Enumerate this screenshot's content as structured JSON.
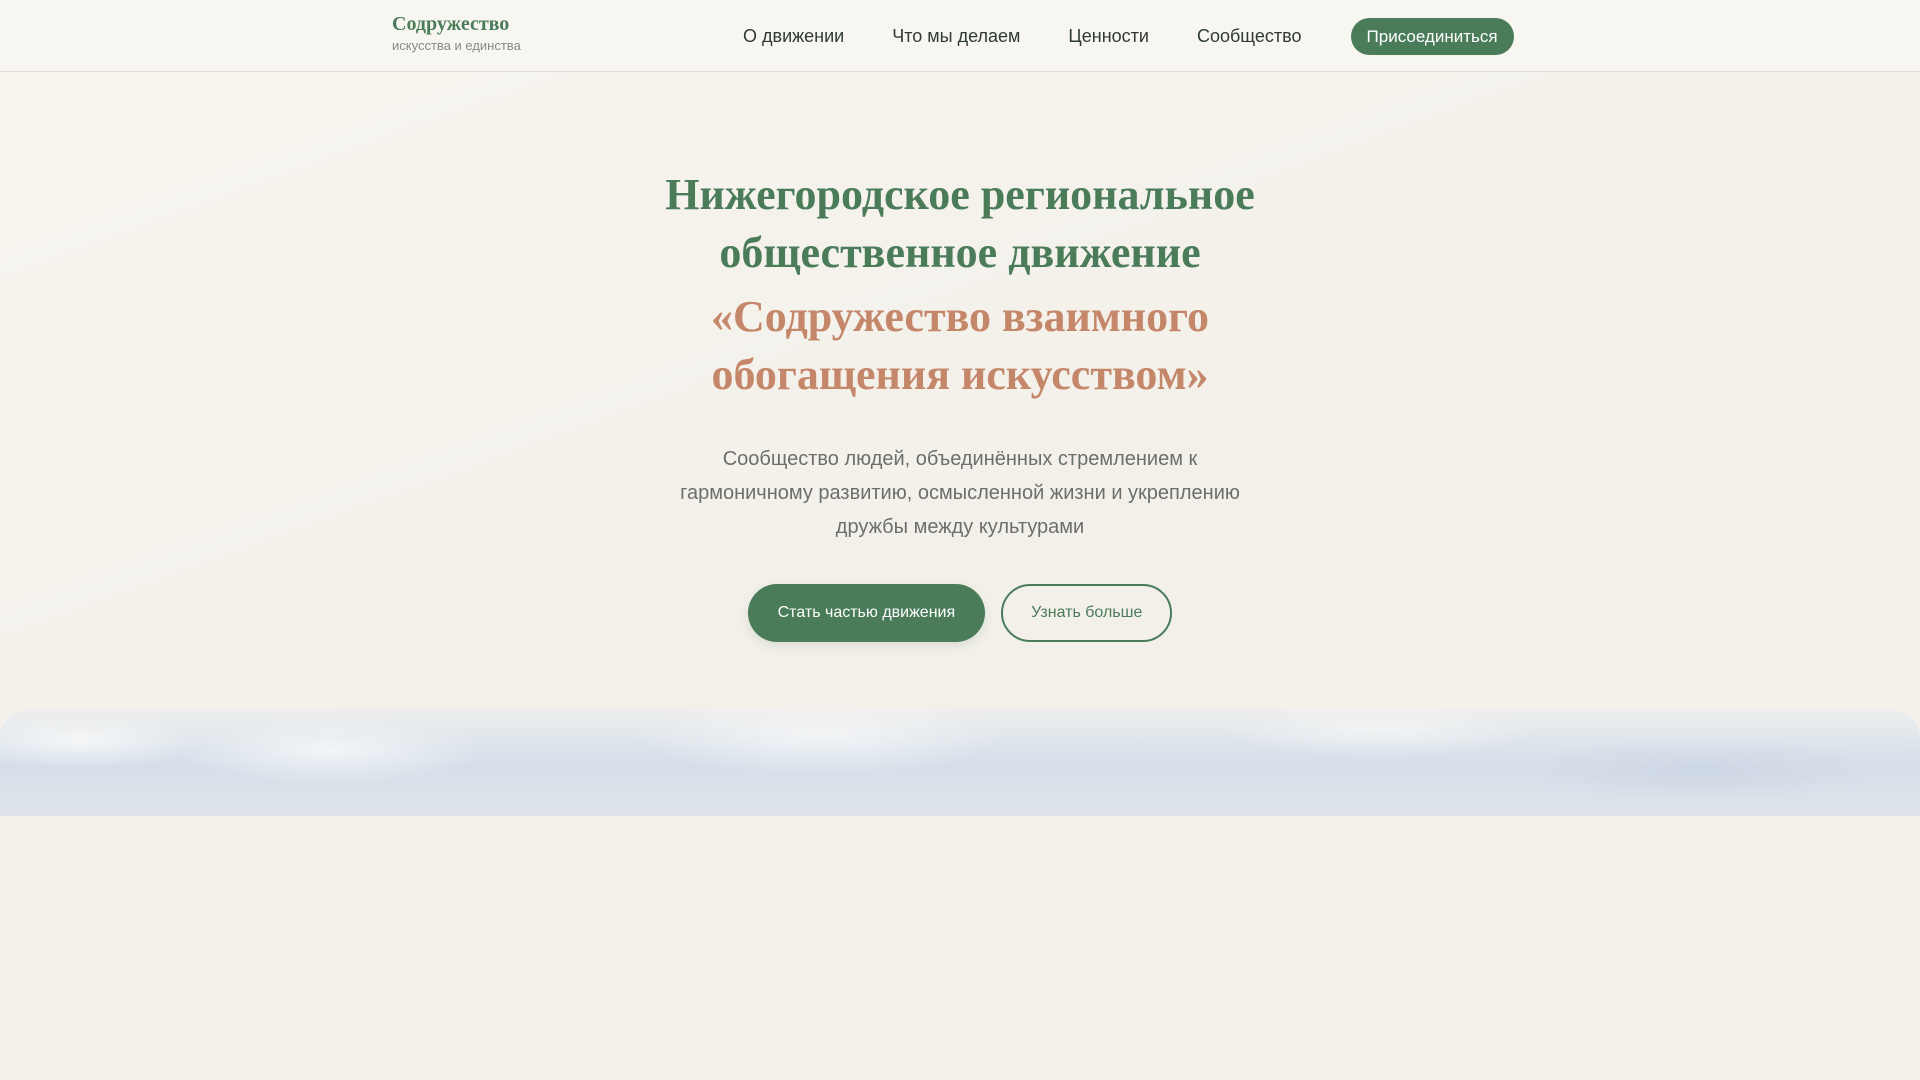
{
  "header": {
    "brand_name": "Содружество",
    "brand_tagline": "искусства и единства",
    "nav": [
      {
        "label": "О движении"
      },
      {
        "label": "Что мы делаем"
      },
      {
        "label": "Ценности"
      },
      {
        "label": "Сообщество"
      }
    ],
    "join_label": "Присоединиться"
  },
  "hero": {
    "title_lines": [
      "Нижегородское региональное",
      "общественное движение"
    ],
    "subtitle_lines": [
      "«Содружество взаимного",
      "обогащения искусством»"
    ],
    "description_lines": [
      "Сообщество людей, объединённых стремлением к",
      "гармоничному развитию, осмысленной жизни и укреплению",
      "дружбы между культурами"
    ],
    "primary_button": "Стать частью движения",
    "secondary_button": "Узнать больше"
  },
  "colors": {
    "brand_green": "#4a7c59",
    "accent_terracotta": "#c5876a",
    "background": "#f5f2ec"
  }
}
